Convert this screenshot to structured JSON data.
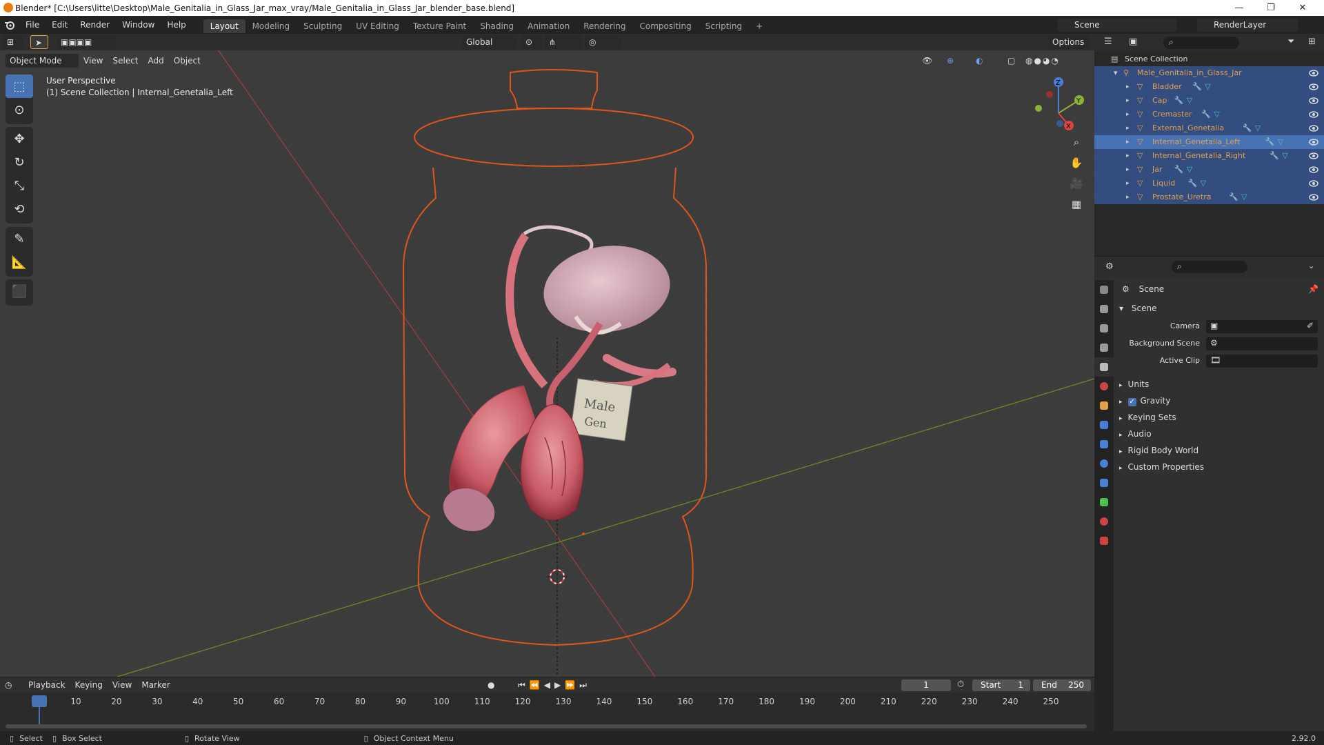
{
  "titlebar": {
    "title": "Blender* [C:\\Users\\litte\\Desktop\\Male_Genitalia_in_Glass_Jar_max_vray/Male_Genitalia_in_Glass_Jar_blender_base.blend]",
    "minimize": "—",
    "maximize": "❐",
    "close": "✕"
  },
  "menubar": {
    "items": [
      "File",
      "Edit",
      "Render",
      "Window",
      "Help"
    ],
    "workspaces": [
      "Layout",
      "Modeling",
      "Sculpting",
      "UV Editing",
      "Texture Paint",
      "Shading",
      "Animation",
      "Rendering",
      "Compositing",
      "Scripting"
    ],
    "add_workspace": "+",
    "scene": "Scene",
    "view_layer": "RenderLayer"
  },
  "viewport": {
    "mode": "Object Mode",
    "menus": [
      "View",
      "Select",
      "Add",
      "Object"
    ],
    "transform_orientation": "Global",
    "options": "Options",
    "overlay_title": "User Perspective",
    "overlay_subtitle": "(1) Scene Collection | Internal_Genetalia_Left",
    "gizmo": {
      "x": "X",
      "y": "Y",
      "z": "Z"
    },
    "label_text_1": "Male",
    "label_text_2": "Gen"
  },
  "timeline": {
    "menus": [
      "Playback",
      "Keying",
      "View",
      "Marker"
    ],
    "current_frame": "1",
    "start_label": "Start",
    "start_value": "1",
    "end_label": "End",
    "end_value": "250",
    "ticks": [
      "1",
      "10",
      "20",
      "30",
      "40",
      "50",
      "60",
      "70",
      "80",
      "90",
      "100",
      "110",
      "120",
      "130",
      "140",
      "150",
      "160",
      "170",
      "180",
      "190",
      "200",
      "210",
      "220",
      "230",
      "240",
      "250"
    ]
  },
  "statusbar": {
    "select": "Select",
    "box_select": "Box Select",
    "rotate": "Rotate View",
    "context": "Object Context Menu",
    "version": "2.92.0"
  },
  "outliner": {
    "root": "Scene Collection",
    "collection": "Male_Genitalia_in_Glass_Jar",
    "objects": [
      "Bladder",
      "Cap",
      "Cremaster",
      "External_Genetalia",
      "Internal_Genetalia_Left",
      "Internal_Genetalia_Right",
      "Jar",
      "Liquid",
      "Prostate_Uretra"
    ],
    "active_index": 4
  },
  "properties": {
    "context": "Scene",
    "panel_title": "Scene",
    "fields": {
      "camera": "Camera",
      "background_scene": "Background Scene",
      "active_clip": "Active Clip"
    },
    "subpanels": [
      "Units",
      "Gravity",
      "Keying Sets",
      "Audio",
      "Rigid Body World",
      "Custom Properties"
    ],
    "gravity_checked": true
  },
  "colors": {
    "accent": "#4772b3",
    "selection_outline": "#e0561a",
    "x_axis": "#a83c3c",
    "y_axis": "#6a8f2a",
    "object_icon": "#e5a047"
  }
}
